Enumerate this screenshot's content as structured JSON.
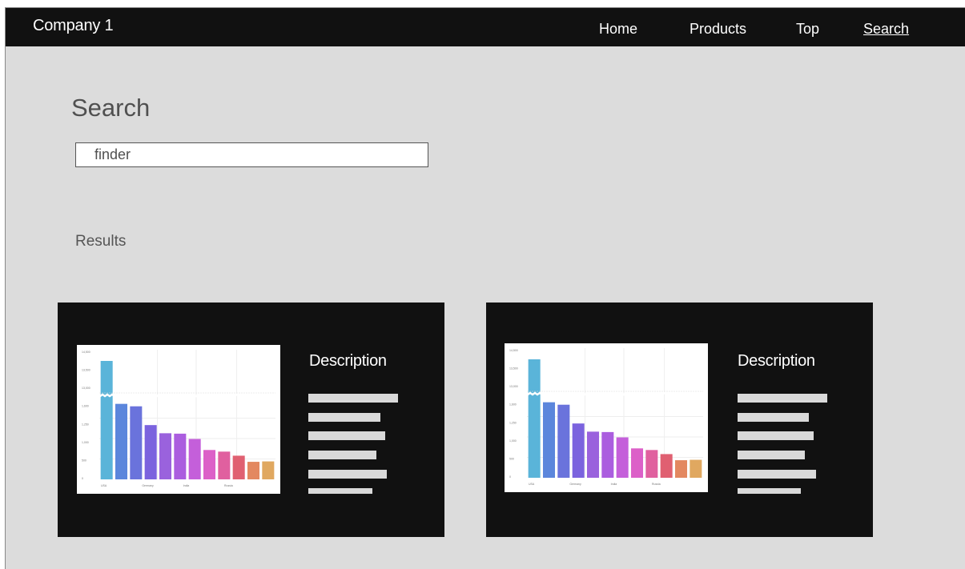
{
  "navbar": {
    "brand": "Company 1",
    "links": [
      {
        "label": "Home",
        "active": false
      },
      {
        "label": "Products",
        "active": false
      },
      {
        "label": "Top",
        "active": false
      },
      {
        "label": "Search",
        "active": true
      }
    ]
  },
  "search": {
    "title": "Search",
    "query": "finder"
  },
  "results": {
    "label": "Results",
    "items": [
      {
        "description_title": "Description",
        "thumbnail_icon": "bar-chart-thumbnail",
        "chart_data": {
          "type": "bar",
          "values": [
            14500,
            1850,
            1790,
            1330,
            1130,
            1120,
            990,
            720,
            680,
            580,
            430,
            440
          ],
          "colors": [
            "#5ab4d9",
            "#5b86dc",
            "#6a73dc",
            "#7b63de",
            "#9a62dd",
            "#ab5ddf",
            "#c45fda",
            "#dc60c8",
            "#e0609f",
            "#e06071",
            "#e38860",
            "#e0a860"
          ],
          "tick_labels": [
            "USA",
            "Germany",
            "India",
            "Russia"
          ],
          "y_ticks": [
            "14,500",
            "13,500",
            "13,000",
            "1,600",
            "1,250",
            "1,000",
            "500",
            "0"
          ],
          "broken_axis": true
        }
      },
      {
        "description_title": "Description",
        "thumbnail_icon": "bar-chart-thumbnail",
        "chart_data": {
          "type": "bar",
          "values": [
            14500,
            1850,
            1790,
            1330,
            1130,
            1120,
            990,
            720,
            680,
            580,
            430,
            440
          ],
          "colors": [
            "#5ab4d9",
            "#5b86dc",
            "#6a73dc",
            "#7b63de",
            "#9a62dd",
            "#ab5ddf",
            "#c45fda",
            "#dc60c8",
            "#e0609f",
            "#e06071",
            "#e38860",
            "#e0a860"
          ],
          "tick_labels": [
            "USA",
            "Germany",
            "India",
            "Russia"
          ],
          "y_ticks": [
            "14,500",
            "13,500",
            "13,000",
            "1,600",
            "1,250",
            "1,000",
            "500",
            "0"
          ],
          "broken_axis": true
        }
      }
    ]
  }
}
